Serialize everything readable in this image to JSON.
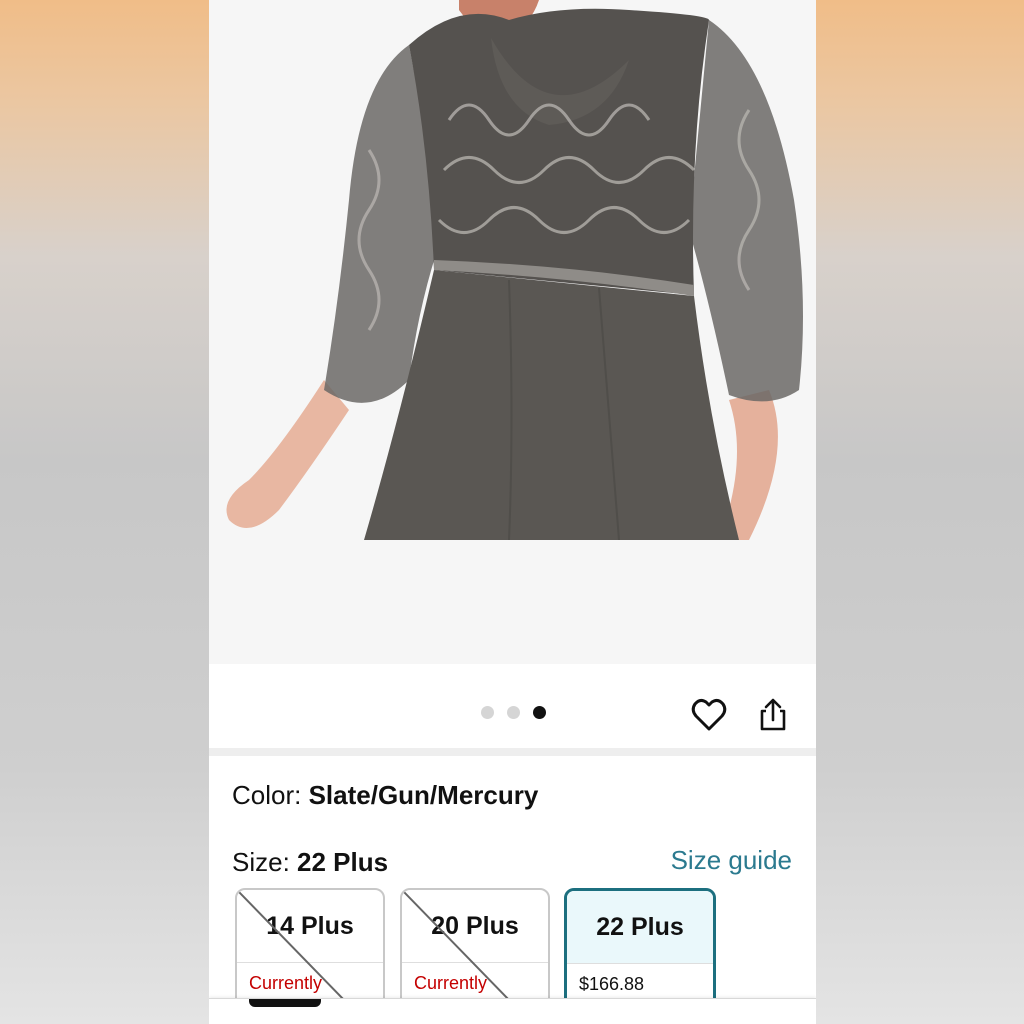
{
  "product": {
    "image_count": 3,
    "active_image_index": 3
  },
  "details": {
    "color_prefix": "Color: ",
    "color_value": "Slate/Gun/Mercury",
    "size_prefix": "Size: ",
    "size_value": "22 Plus",
    "size_guide_label": "Size guide"
  },
  "sizes": [
    {
      "label": "14 Plus",
      "sub": "Currently",
      "available": false
    },
    {
      "label": "20 Plus",
      "sub": "Currently",
      "available": false
    },
    {
      "label": "22 Plus",
      "sub": "$166.88",
      "available": true,
      "selected": true
    }
  ],
  "icons": {
    "favorite": "heart-icon",
    "share": "share-icon"
  },
  "colors": {
    "accent": "#1c6f7f",
    "link": "#2b7a8f",
    "unavailable_text": "#c40000"
  }
}
